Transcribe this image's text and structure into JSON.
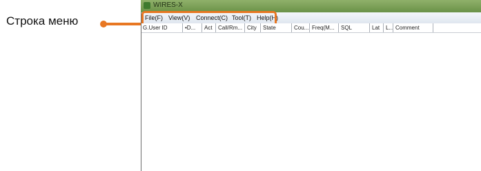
{
  "annotation": {
    "label": "Строка меню",
    "color": "#e87722"
  },
  "window": {
    "title": "WIRES-X"
  },
  "menubar": [
    {
      "label": "File(F)"
    },
    {
      "label": "View(V)"
    },
    {
      "label": "Connect(C)"
    },
    {
      "label": "Tool(T)"
    },
    {
      "label": "Help(H)"
    }
  ],
  "list": {
    "columns": [
      {
        "label": "G.User ID"
      },
      {
        "label": "•D..."
      },
      {
        "label": "Act"
      },
      {
        "label": "Call/Rm..."
      },
      {
        "label": "City"
      },
      {
        "label": "State"
      },
      {
        "label": "Cou..."
      },
      {
        "label": "Freq(M..."
      },
      {
        "label": "SQL"
      },
      {
        "label": "Lat"
      },
      {
        "label": "L..."
      },
      {
        "label": "Comment"
      }
    ],
    "rows": []
  }
}
